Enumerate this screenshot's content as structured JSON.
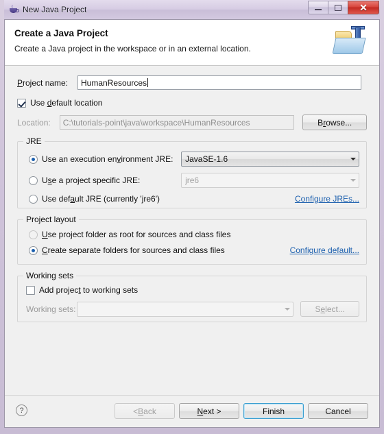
{
  "window": {
    "title": "New Java Project",
    "icon": "java-cup-icon",
    "controls": {
      "minimize": "minimize-icon",
      "maximize": "maximize-icon",
      "close": "✕"
    }
  },
  "header": {
    "title": "Create a Java Project",
    "description": "Create a Java project in the workspace or in an external location.",
    "banner_icon": "java-project-folder-icon"
  },
  "project": {
    "name_label": "Project name:",
    "name_label_mnemonic": "P",
    "name_value": "HumanResources",
    "use_default_location_label": "Use default location",
    "use_default_location_mnemonic": "d",
    "use_default_location_checked": true,
    "location_label": "Location:",
    "location_value": "C:\\tutorials-point\\java\\workspace\\HumanResources",
    "browse_label": "Browse...",
    "browse_mnemonic": "r",
    "location_enabled": false
  },
  "jre": {
    "group_label": "JRE",
    "options": [
      {
        "label": "Use an execution environment JRE:",
        "mnemonic": "v",
        "selected": true,
        "combo_value": "JavaSE-1.6",
        "combo_enabled": true
      },
      {
        "label": "Use a project specific JRE:",
        "mnemonic": "s",
        "selected": false,
        "combo_value": "jre6",
        "combo_enabled": false
      },
      {
        "label": "Use default JRE (currently 'jre6')",
        "mnemonic": "a",
        "selected": false
      }
    ],
    "configure_link": "Configure JREs..."
  },
  "project_layout": {
    "group_label": "Project layout",
    "options": [
      {
        "label": "Use project folder as root for sources and class files",
        "mnemonic": "U",
        "selected": false,
        "enabled": false
      },
      {
        "label": "Create separate folders for sources and class files",
        "mnemonic": "C",
        "selected": true,
        "enabled": true
      }
    ],
    "configure_link": "Configure default..."
  },
  "working_sets": {
    "group_label": "Working sets",
    "add_label": "Add project to working sets",
    "add_mnemonic": "t",
    "add_checked": false,
    "sets_label": "Working sets:",
    "sets_value": "",
    "select_label": "Select...",
    "select_mnemonic": "e",
    "enabled": false
  },
  "footer": {
    "help_icon": "?",
    "buttons": [
      {
        "label": "< Back",
        "name": "back-button",
        "state": "disabled"
      },
      {
        "label": "Next >",
        "name": "next-button",
        "state": "enabled"
      },
      {
        "label": "Finish",
        "name": "finish-button",
        "state": "default"
      },
      {
        "label": "Cancel",
        "name": "cancel-button",
        "state": "enabled"
      }
    ]
  },
  "colors": {
    "accent_link": "#1b5fae",
    "default_button_border": "#3c9fd1",
    "frame": "#cfc3da",
    "close_button": "#d8453c"
  }
}
